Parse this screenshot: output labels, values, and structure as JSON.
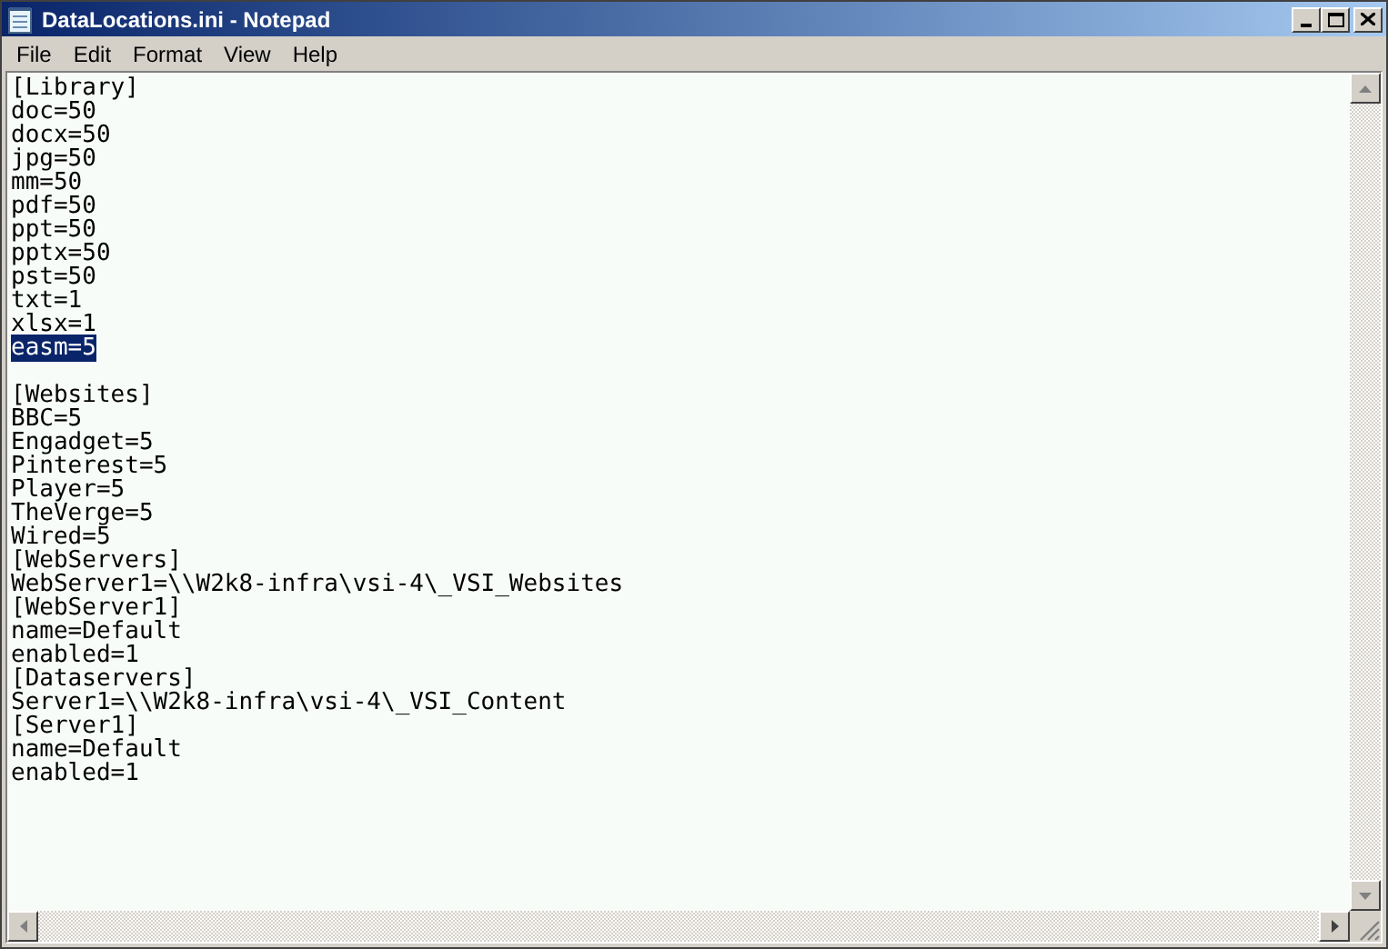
{
  "window": {
    "title": "DataLocations.ini - Notepad"
  },
  "menu": [
    "File",
    "Edit",
    "Format",
    "View",
    "Help"
  ],
  "lines": [
    {
      "kind": "text",
      "text": "[Library]",
      "selected": false
    },
    {
      "kind": "text",
      "text": "doc=50",
      "selected": false
    },
    {
      "kind": "text",
      "text": "docx=50",
      "selected": false
    },
    {
      "kind": "text",
      "text": "jpg=50",
      "selected": false
    },
    {
      "kind": "text",
      "text": "mm=50",
      "selected": false
    },
    {
      "kind": "text",
      "text": "pdf=50",
      "selected": false
    },
    {
      "kind": "text",
      "text": "ppt=50",
      "selected": false
    },
    {
      "kind": "text",
      "text": "pptx=50",
      "selected": false
    },
    {
      "kind": "text",
      "text": "pst=50",
      "selected": false
    },
    {
      "kind": "text",
      "text": "txt=1",
      "selected": false
    },
    {
      "kind": "text",
      "text": "xlsx=1",
      "selected": false
    },
    {
      "kind": "text",
      "text": "easm=5",
      "selected": true
    },
    {
      "kind": "blank"
    },
    {
      "kind": "text",
      "text": "[Websites]",
      "selected": false
    },
    {
      "kind": "text",
      "text": "BBC=5",
      "selected": false
    },
    {
      "kind": "text",
      "text": "Engadget=5",
      "selected": false
    },
    {
      "kind": "text",
      "text": "Pinterest=5",
      "selected": false
    },
    {
      "kind": "text",
      "text": "Player=5",
      "selected": false
    },
    {
      "kind": "text",
      "text": "TheVerge=5",
      "selected": false
    },
    {
      "kind": "text",
      "text": "Wired=5",
      "selected": false
    },
    {
      "kind": "text",
      "text": "[WebServers]",
      "selected": false
    },
    {
      "kind": "text",
      "text": "WebServer1=\\\\W2k8-infra\\vsi-4\\_VSI_Websites",
      "selected": false
    },
    {
      "kind": "text",
      "text": "[WebServer1]",
      "selected": false
    },
    {
      "kind": "text",
      "text": "name=Default",
      "selected": false
    },
    {
      "kind": "text",
      "text": "enabled=1",
      "selected": false
    },
    {
      "kind": "text",
      "text": "[Dataservers]",
      "selected": false
    },
    {
      "kind": "text",
      "text": "Server1=\\\\W2k8-infra\\vsi-4\\_VSI_Content",
      "selected": false
    },
    {
      "kind": "text",
      "text": "[Server1]",
      "selected": false
    },
    {
      "kind": "text",
      "text": "name=Default",
      "selected": false
    },
    {
      "kind": "text",
      "text": "enabled=1",
      "selected": false
    }
  ]
}
